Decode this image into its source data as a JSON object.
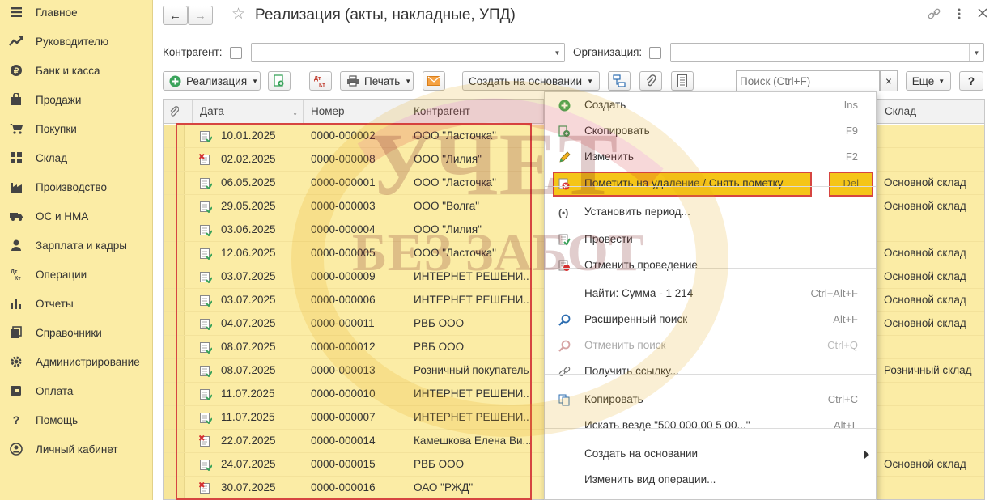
{
  "sidebar": {
    "items": [
      {
        "label": "Главное",
        "icon": "menu-icon"
      },
      {
        "label": "Руководителю",
        "icon": "trend-icon"
      },
      {
        "label": "Банк и касса",
        "icon": "coin-icon"
      },
      {
        "label": "Продажи",
        "icon": "bag-icon"
      },
      {
        "label": "Покупки",
        "icon": "cart-icon"
      },
      {
        "label": "Склад",
        "icon": "warehouse-icon"
      },
      {
        "label": "Производство",
        "icon": "factory-icon"
      },
      {
        "label": "ОС и НМА",
        "icon": "truck-icon"
      },
      {
        "label": "Зарплата и кадры",
        "icon": "person-icon"
      },
      {
        "label": "Операции",
        "icon": "dt-kt-icon"
      },
      {
        "label": "Отчеты",
        "icon": "bar-chart-icon"
      },
      {
        "label": "Справочники",
        "icon": "books-icon"
      },
      {
        "label": "Администрирование",
        "icon": "gear-icon"
      },
      {
        "label": "Оплата",
        "icon": "wallet-icon"
      },
      {
        "label": "Помощь",
        "icon": "question-icon"
      },
      {
        "label": "Личный кабинет",
        "icon": "user-circle-icon"
      }
    ]
  },
  "header": {
    "title": "Реализация (акты, накладные, УПД)",
    "back": "←",
    "forward": "→",
    "star": "☆"
  },
  "filters": {
    "counterparty_label": "Контрагент:",
    "organization_label": "Организация:"
  },
  "toolbar": {
    "create_label": "Реализация",
    "print_label": "Печать",
    "dtkt_label": "Дт Кт",
    "create_based_label": "Создать на основании",
    "search_placeholder": "Поиск (Ctrl+F)",
    "clear_search": "×",
    "more_label": "Еще",
    "help_label": "?"
  },
  "table": {
    "columns": {
      "date": "Дата",
      "number": "Номер",
      "counterparty": "Контрагент",
      "warehouse": "Склад"
    },
    "sort_indicator": "↓",
    "rows": [
      {
        "date": "10.01.2025",
        "number": "0000-000002",
        "counterparty": "ООО \"Ласточка\"",
        "warehouse": "",
        "status": "posted"
      },
      {
        "date": "02.02.2025",
        "number": "0000-000008",
        "counterparty": "ООО \"Лилия\"",
        "warehouse": "",
        "status": "deleted"
      },
      {
        "date": "06.05.2025",
        "number": "0000-000001",
        "counterparty": "ООО \"Ласточка\"",
        "warehouse": "Основной склад",
        "status": "posted"
      },
      {
        "date": "29.05.2025",
        "number": "0000-000003",
        "counterparty": "ООО \"Волга\"",
        "warehouse": "Основной склад",
        "status": "posted"
      },
      {
        "date": "03.06.2025",
        "number": "0000-000004",
        "counterparty": "ООО \"Лилия\"",
        "warehouse": "",
        "status": "posted"
      },
      {
        "date": "12.06.2025",
        "number": "0000-000005",
        "counterparty": "ООО \"Ласточка\"",
        "warehouse": "Основной склад",
        "status": "posted"
      },
      {
        "date": "03.07.2025",
        "number": "0000-000009",
        "counterparty": "ИНТЕРНЕТ РЕШЕНИ...",
        "warehouse": "Основной склад",
        "status": "posted"
      },
      {
        "date": "03.07.2025",
        "number": "0000-000006",
        "counterparty": "ИНТЕРНЕТ РЕШЕНИ...",
        "warehouse": "Основной склад",
        "status": "posted"
      },
      {
        "date": "04.07.2025",
        "number": "0000-000011",
        "counterparty": "РВБ ООО",
        "warehouse": "Основной склад",
        "status": "posted"
      },
      {
        "date": "08.07.2025",
        "number": "0000-000012",
        "counterparty": "РВБ ООО",
        "warehouse": "",
        "status": "posted"
      },
      {
        "date": "08.07.2025",
        "number": "0000-000013",
        "counterparty": "Розничный покупатель",
        "warehouse": "Розничный склад",
        "status": "posted"
      },
      {
        "date": "11.07.2025",
        "number": "0000-000010",
        "counterparty": "ИНТЕРНЕТ РЕШЕНИ...",
        "warehouse": "",
        "status": "posted"
      },
      {
        "date": "11.07.2025",
        "number": "0000-000007",
        "counterparty": "ИНТЕРНЕТ РЕШЕНИ...",
        "warehouse": "",
        "status": "posted"
      },
      {
        "date": "22.07.2025",
        "number": "0000-000014",
        "counterparty": "Камешкова Елена Ви...",
        "warehouse": "",
        "status": "deleted"
      },
      {
        "date": "24.07.2025",
        "number": "0000-000015",
        "counterparty": "РВБ ООО",
        "warehouse": "Основной склад",
        "status": "posted"
      },
      {
        "date": "30.07.2025",
        "number": "0000-000016",
        "counterparty": "ОАО \"РЖД\"",
        "warehouse": "",
        "status": "deleted"
      }
    ]
  },
  "context_menu": {
    "items": [
      {
        "label": "Создать",
        "shortcut": "Ins",
        "icon": "plus-circle-icon",
        "enabled": true
      },
      {
        "label": "Скопировать",
        "shortcut": "F9",
        "icon": "copy-doc-icon",
        "enabled": true
      },
      {
        "label": "Изменить",
        "shortcut": "F2",
        "icon": "pencil-icon",
        "enabled": true
      },
      {
        "label": "Пометить на удаление / Снять пометку",
        "shortcut": "Del",
        "icon": "delete-mark-icon",
        "enabled": true,
        "highlighted": true
      },
      {
        "label": "Установить период...",
        "shortcut": "",
        "icon": "period-icon",
        "enabled": true
      },
      {
        "label": "Провести",
        "shortcut": "",
        "icon": "post-icon",
        "enabled": true
      },
      {
        "label": "Отменить проведение",
        "shortcut": "",
        "icon": "unpost-icon",
        "enabled": true
      },
      {
        "label": "Найти: Сумма - 1 214",
        "shortcut": "Ctrl+Alt+F",
        "icon": "",
        "enabled": true
      },
      {
        "label": "Расширенный поиск",
        "shortcut": "Alt+F",
        "icon": "search-icon",
        "enabled": true
      },
      {
        "label": "Отменить поиск",
        "shortcut": "Ctrl+Q",
        "icon": "cancel-search-icon",
        "enabled": false
      },
      {
        "label": "Получить ссылку...",
        "shortcut": "",
        "icon": "link-icon",
        "enabled": true
      },
      {
        "label": "Копировать",
        "shortcut": "Ctrl+C",
        "icon": "copy-icon",
        "enabled": true
      },
      {
        "label": "Искать везде \"500 000,00 5 00...\"",
        "shortcut": "Alt+L",
        "icon": "",
        "enabled": true
      },
      {
        "label": "Создать на основании",
        "shortcut": "",
        "icon": "",
        "enabled": true,
        "submenu": true
      },
      {
        "label": "Изменить вид операции...",
        "shortcut": "",
        "icon": "",
        "enabled": true
      }
    ]
  },
  "watermark": {
    "line1": "УЧЕТ",
    "line2": "БЕЗ ЗАБОТ"
  },
  "colors": {
    "sidebar_bg": "#fbeca5",
    "row_bg": "#fbeca5",
    "highlight_bg": "#f5c518",
    "annotation_red": "#d64541"
  }
}
